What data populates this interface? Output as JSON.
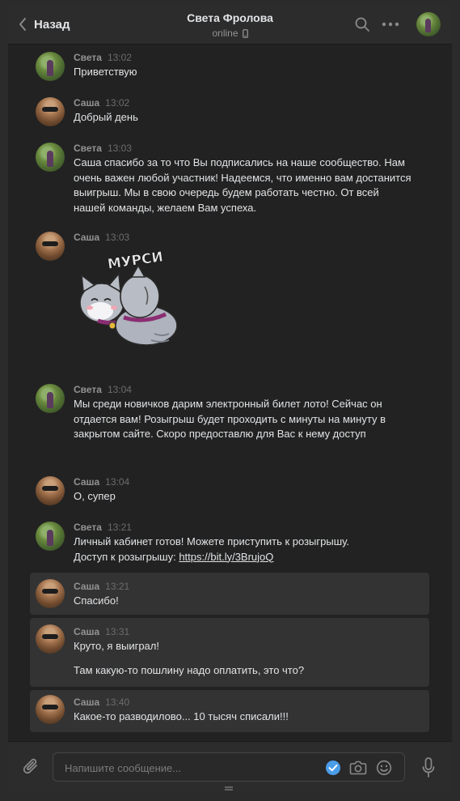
{
  "header": {
    "back_label": "Назад",
    "title": "Света Фролова",
    "status": "online"
  },
  "icons": {
    "back": "chevron-left-icon",
    "search": "search-icon",
    "more": "more-dots-icon",
    "phone": "mobile-phone-icon",
    "attach": "paperclip-icon",
    "check": "check-circle-icon",
    "camera": "camera-icon",
    "smile": "smile-icon",
    "mic": "microphone-icon"
  },
  "colors": {
    "background": "#222222",
    "header": "#2c2c2c",
    "selected": "#333333",
    "accent": "#4a9de8",
    "text": "#e1e3e6",
    "muted": "#939393"
  },
  "messages": [
    {
      "author": "Света",
      "time": "13:02",
      "text": "Приветствую"
    },
    {
      "author": "Саша",
      "time": "13:02",
      "text": "Добрый день"
    },
    {
      "author": "Света",
      "time": "13:03",
      "text": "Саша спасибо за то что Вы подписались на наше сообщество. Нам очень важен любой участник! Надеемся, что именно вам достанится выигрыш. Мы в свою очередь будем работать честно. От всей нашей команды, желаем Вам успеха."
    },
    {
      "author": "Саша",
      "time": "13:03",
      "sticker_text": "МУРСИ"
    },
    {
      "author": "Света",
      "time": "13:04",
      "text": "Мы среди новичков дарим электронный билет лото! Сейчас он отдается вам! Розыгрыш будет проходить с минуты на минуту в закрытом сайте. Скоро предоставлю для Вас к нему доступ"
    },
    {
      "author": "Саша",
      "time": "13:04",
      "text": "О, супер"
    },
    {
      "author": "Света",
      "time": "13:21",
      "text_line1": "Личный кабинет готов! Можете приступить к розыгрышу.",
      "text_prefix": "Доступ к розыгрышу: ",
      "link": "https://bit.ly/3BrujoQ"
    },
    {
      "author": "Саша",
      "time": "13:21",
      "text": "Спасибо!",
      "selected": true
    },
    {
      "author": "Саша",
      "time": "13:31",
      "text_line1": "Круто, я выиграл!",
      "text_line2": "Там какую-то пошлину надо оплатить, это что?",
      "selected": true
    },
    {
      "author": "Саша",
      "time": "13:40",
      "text": "Какое-то разводилово... 10 тысяч списали!!!",
      "selected": true
    }
  ],
  "composer": {
    "placeholder": "Напишите сообщение..."
  }
}
